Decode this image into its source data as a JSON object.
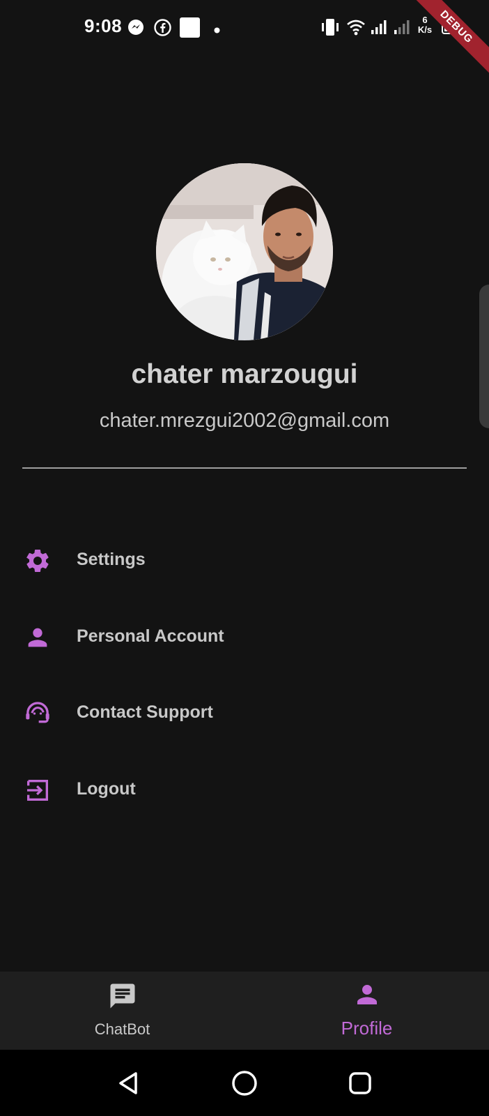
{
  "status_bar": {
    "time": "9:08",
    "net_speed_value": "6",
    "net_speed_unit": "K/s",
    "debug_label": "DEBUG",
    "icons": [
      "messenger-icon",
      "facebook-icon",
      "square-notification-icon",
      "dot-icon",
      "vibrate-icon",
      "wifi-icon",
      "signal-icon",
      "signal-weak-icon",
      "battery-icon"
    ]
  },
  "profile": {
    "name": "chater marzougui",
    "email": "chater.mrezgui2002@gmail.com",
    "avatar": "profile-photo"
  },
  "menu": {
    "items": [
      {
        "label": "Settings",
        "icon": "gear-icon"
      },
      {
        "label": "Personal Account",
        "icon": "person-icon"
      },
      {
        "label": "Contact Support",
        "icon": "support-agent-icon"
      },
      {
        "label": "Logout",
        "icon": "logout-icon"
      }
    ]
  },
  "bottom_nav": {
    "items": [
      {
        "label": "ChatBot",
        "icon": "chat-icon",
        "active": false
      },
      {
        "label": "Profile",
        "icon": "person-icon",
        "active": true
      }
    ]
  },
  "colors": {
    "background": "#131313",
    "accent": "#c16ad6",
    "nav_background": "#1f1f1f",
    "text": "#c8c8c8"
  }
}
